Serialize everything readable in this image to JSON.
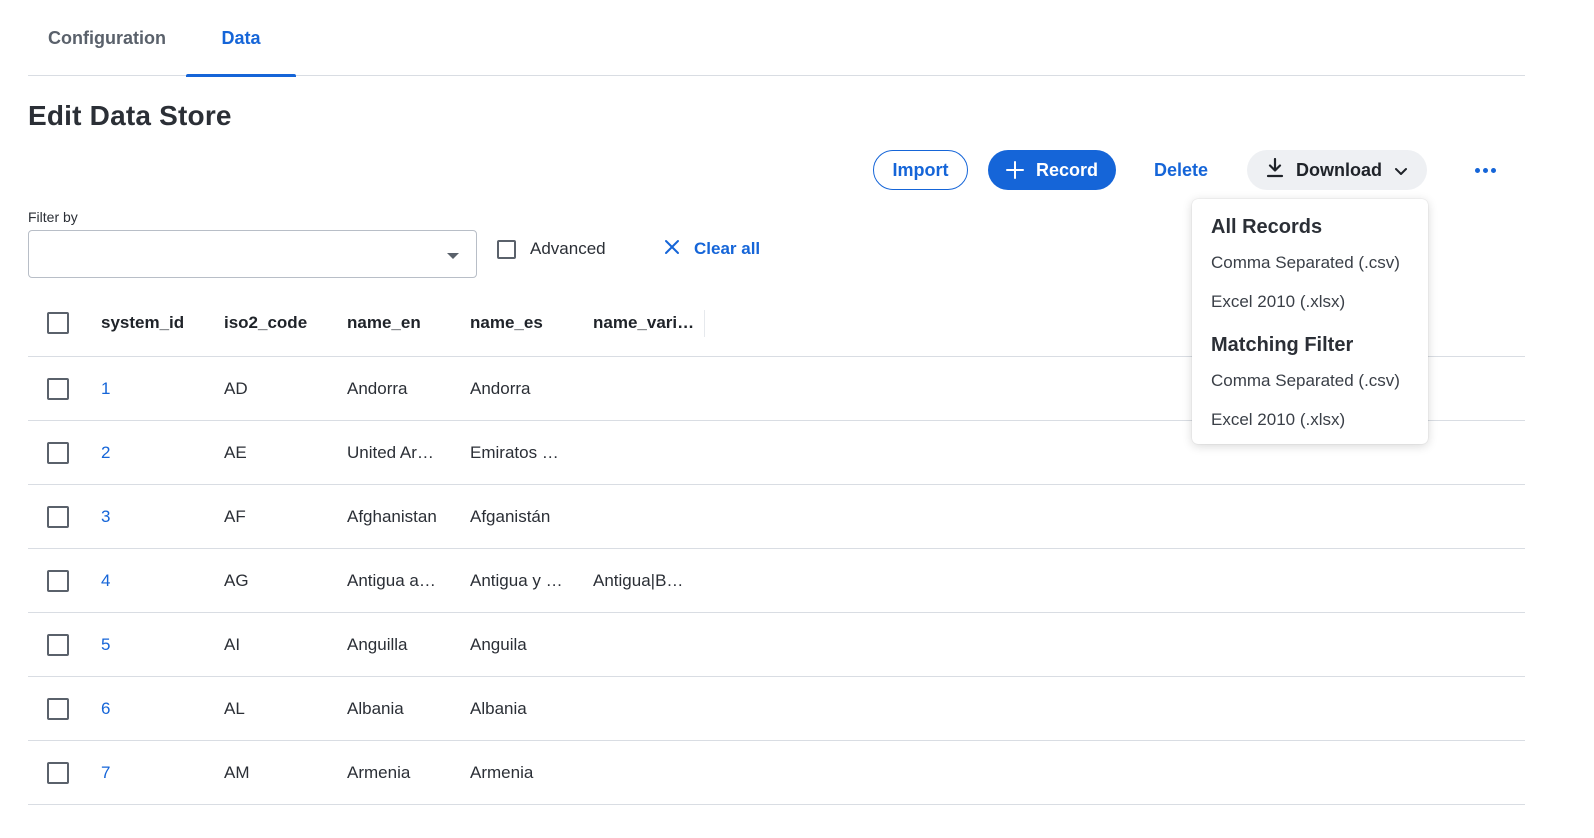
{
  "tabs": [
    {
      "label": "Configuration",
      "active": false
    },
    {
      "label": "Data",
      "active": true
    }
  ],
  "page_title": "Edit Data Store",
  "toolbar": {
    "import_label": "Import",
    "record_label": "Record",
    "delete_label": "Delete",
    "download_label": "Download",
    "more_icon": "more-horizontal-icon"
  },
  "filter": {
    "label": "Filter by",
    "value": "",
    "advanced_label": "Advanced",
    "advanced_checked": false,
    "clear_label": "Clear all"
  },
  "table": {
    "columns": [
      "system_id",
      "iso2_code",
      "name_en",
      "name_es",
      "name_vari…"
    ],
    "rows": [
      {
        "system_id": "1",
        "iso2_code": "AD",
        "name_en": "Andorra",
        "name_es": "Andorra",
        "name_variants": ""
      },
      {
        "system_id": "2",
        "iso2_code": "AE",
        "name_en": "United Ar…",
        "name_es": "Emiratos …",
        "name_variants": ""
      },
      {
        "system_id": "3",
        "iso2_code": "AF",
        "name_en": "Afghanistan",
        "name_es": "Afganistán",
        "name_variants": ""
      },
      {
        "system_id": "4",
        "iso2_code": "AG",
        "name_en": "Antigua a…",
        "name_es": "Antigua y …",
        "name_variants": "Antigua|B…"
      },
      {
        "system_id": "5",
        "iso2_code": "AI",
        "name_en": "Anguilla",
        "name_es": "Anguila",
        "name_variants": ""
      },
      {
        "system_id": "6",
        "iso2_code": "AL",
        "name_en": "Albania",
        "name_es": "Albania",
        "name_variants": ""
      },
      {
        "system_id": "7",
        "iso2_code": "AM",
        "name_en": "Armenia",
        "name_es": "Armenia",
        "name_variants": ""
      }
    ]
  },
  "download_menu": {
    "all_records": {
      "heading": "All Records",
      "csv": "Comma Separated (.csv)",
      "xlsx": "Excel 2010 (.xlsx)"
    },
    "matching_filter": {
      "heading": "Matching Filter",
      "csv": "Comma Separated (.csv)",
      "xlsx": "Excel 2010 (.xlsx)"
    }
  },
  "colors": {
    "accent": "#1565d8",
    "text": "#2b2f36",
    "border": "#d9dde3"
  }
}
